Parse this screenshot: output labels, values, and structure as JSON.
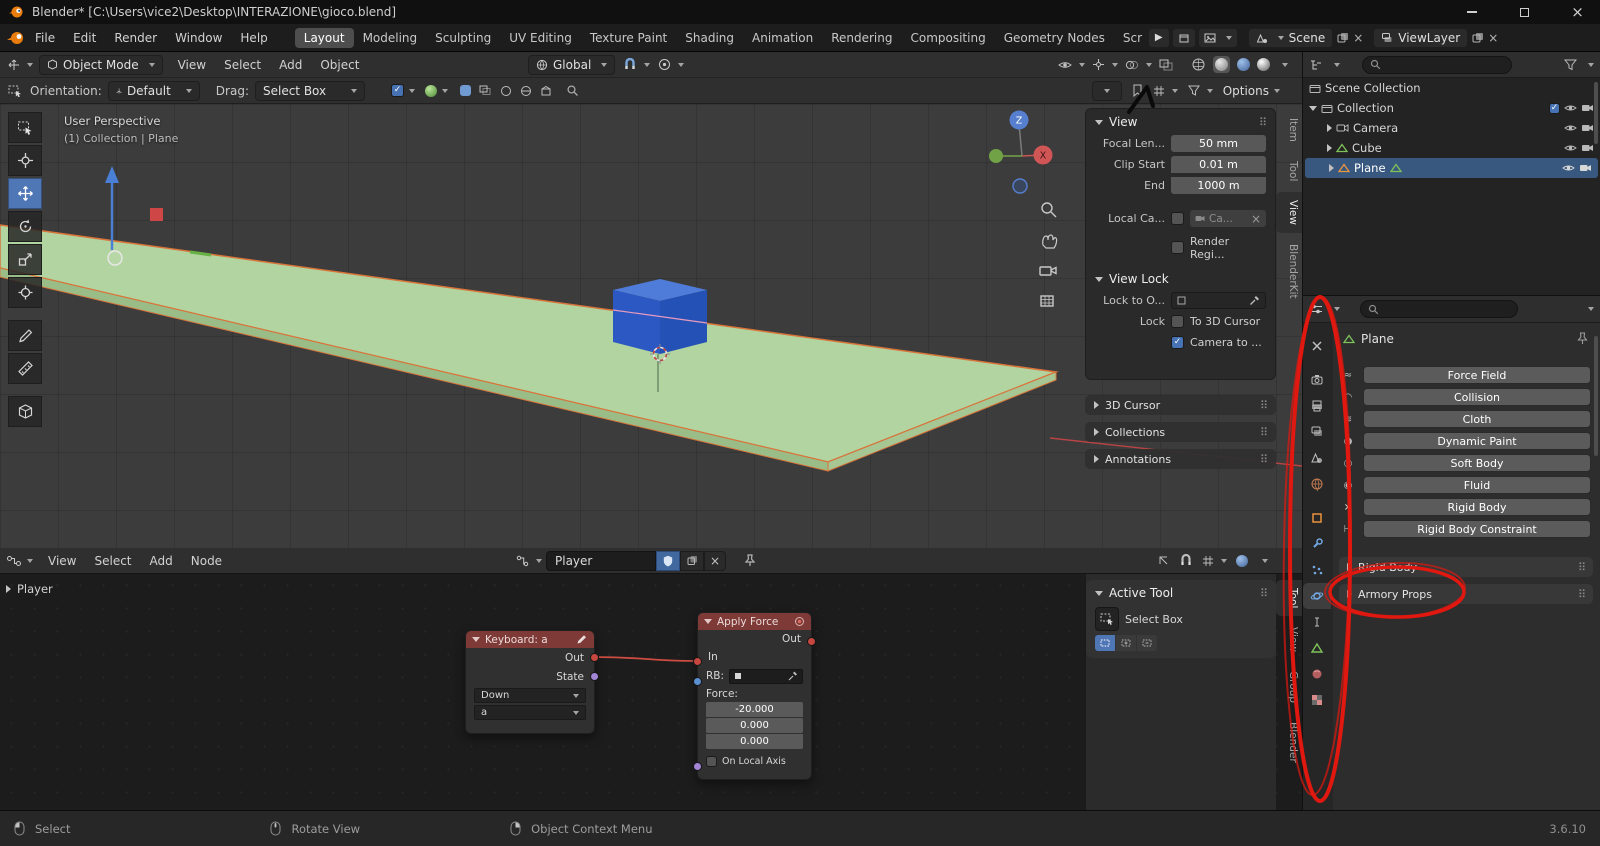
{
  "titlebar": {
    "title": "Blender* [C:\\Users\\vice2\\Desktop\\INTERAZIONE\\gioco.blend]"
  },
  "topbar": {
    "menus": [
      "File",
      "Edit",
      "Render",
      "Window",
      "Help"
    ],
    "workspaces": [
      "Layout",
      "Modeling",
      "Sculpting",
      "UV Editing",
      "Texture Paint",
      "Shading",
      "Animation",
      "Rendering",
      "Compositing",
      "Geometry Nodes",
      "Scr"
    ],
    "scene_label": "Scene",
    "viewlayer_label": "ViewLayer"
  },
  "viewport_header": {
    "mode": "Object Mode",
    "menus": [
      "View",
      "Select",
      "Add",
      "Object"
    ],
    "orientation": "Global"
  },
  "tool_settings": {
    "orientation_label": "Orientation:",
    "orientation_value": "Default",
    "drag_label": "Drag:",
    "drag_value": "Select Box",
    "options_label": "Options"
  },
  "viewport": {
    "overlay_line1": "User Perspective",
    "overlay_line2": "(1) Collection | Plane",
    "axis_z": "Z",
    "axis_x": "X"
  },
  "n_panel": {
    "tabs": [
      "Item",
      "Tool",
      "View",
      "BlenderKit"
    ],
    "view": {
      "title": "View",
      "focal_label": "Focal Len...",
      "focal_value": "50 mm",
      "clip_start_label": "Clip Start",
      "clip_start_value": "0.01 m",
      "clip_end_label": "End",
      "clip_end_value": "1000 m",
      "local_camera_label": "Local Ca...",
      "local_camera_value": "Ca...",
      "render_region_label": "Render Regi..."
    },
    "view_lock": {
      "title": "View Lock",
      "lock_to_label": "Lock to O...",
      "lock_label": "Lock",
      "to_3d_cursor_label": "To 3D Cursor",
      "camera_to_label": "Camera to ..."
    },
    "collapsed": [
      "3D Cursor",
      "Collections",
      "Annotations"
    ]
  },
  "outliner": {
    "scene_collection": "Scene Collection",
    "collection": "Collection",
    "items": [
      "Camera",
      "Cube",
      "Plane"
    ]
  },
  "properties": {
    "breadcrumb": "Plane",
    "physics_buttons": [
      "Force Field",
      "Collision",
      "Cloth",
      "Dynamic Paint",
      "Soft Body",
      "Fluid",
      "Rigid Body",
      "Rigid Body Constraint"
    ],
    "rigid_body_section": "Rigid Body",
    "armory_props_section": "Armory Props"
  },
  "node_editor": {
    "menus": [
      "View",
      "Select",
      "Add",
      "Node"
    ],
    "tree_name": "Player",
    "breadcrumb": "Player",
    "sidebar_tabs": [
      "Tool",
      "View",
      "Group",
      "Blender"
    ],
    "keyboard_node": {
      "title": "Keyboard: a",
      "out_label": "Out",
      "state_label": "State",
      "key_mode": "Down",
      "key_value": "a"
    },
    "apply_force_node": {
      "title": "Apply Force",
      "out_label": "Out",
      "in_label": "In",
      "rb_label": "RB:",
      "force_label": "Force:",
      "force_x": "-20.000",
      "force_y": "0.000",
      "force_z": "0.000",
      "local_axis_label": "On Local Axis"
    },
    "active_tool": {
      "title": "Active Tool",
      "tool_name": "Select Box"
    }
  },
  "statusbar": {
    "select": "Select",
    "rotate_view": "Rotate View",
    "context_menu": "Object Context Menu",
    "version": "3.6.10"
  }
}
